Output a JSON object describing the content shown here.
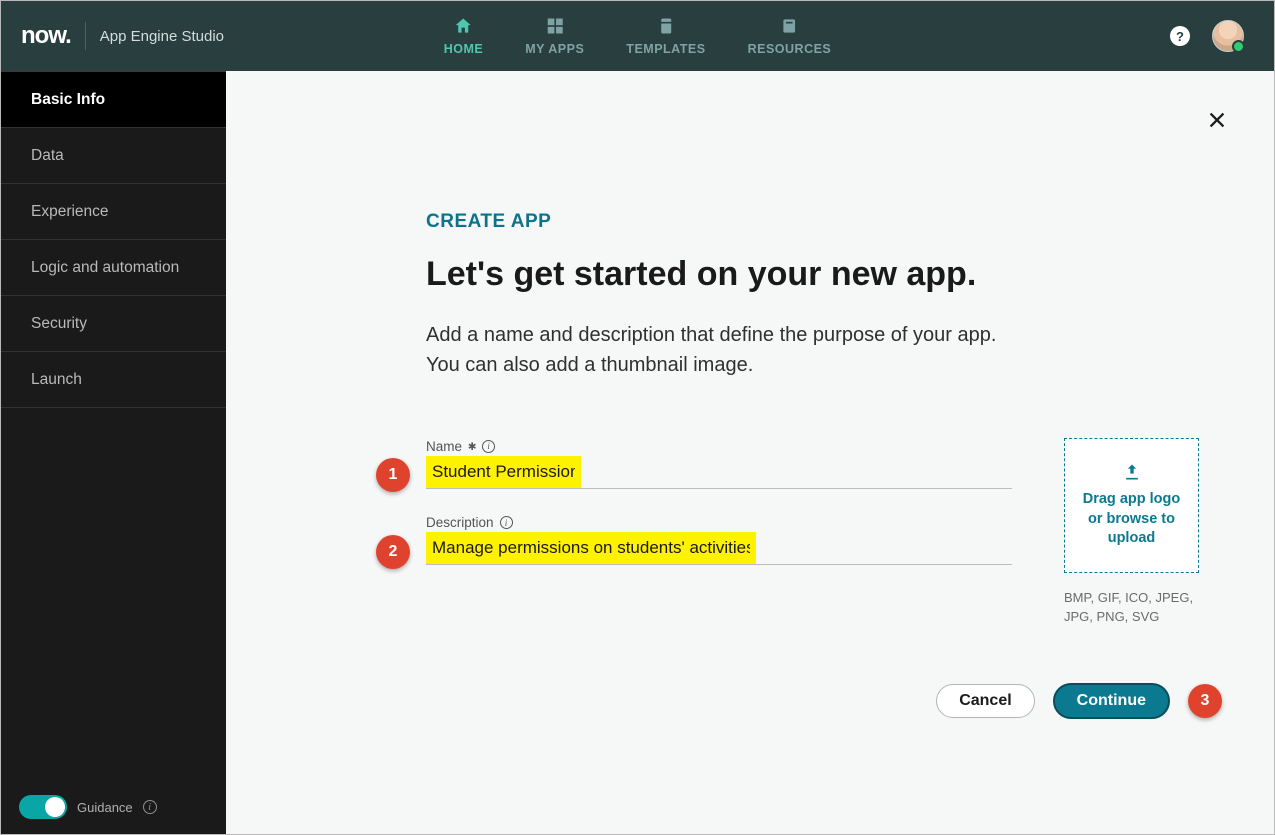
{
  "header": {
    "logo": "now.",
    "title": "App Engine Studio",
    "nav": {
      "home": "HOME",
      "myapps": "MY APPS",
      "templates": "TEMPLATES",
      "resources": "RESOURCES"
    },
    "help": "?"
  },
  "sidebar": {
    "items": [
      "Basic Info",
      "Data",
      "Experience",
      "Logic and automation",
      "Security",
      "Launch"
    ],
    "guidance": "Guidance"
  },
  "main": {
    "eyebrow": "CREATE APP",
    "heading": "Let's get started on your new app.",
    "lead1": "Add a name and description that define the purpose of your app.",
    "lead2": "You can also add a thumbnail image.",
    "name_label": "Name",
    "required_glyph": "✱",
    "name_value": "Student Permission",
    "desc_label": "Description",
    "desc_value": "Manage permissions on students' activities",
    "dropzone_line1": "Drag app logo",
    "dropzone_line2": "or browse to",
    "dropzone_line3": "upload",
    "formats": "BMP, GIF, ICO, JPEG, JPG, PNG, SVG",
    "cancel": "Cancel",
    "continue": "Continue",
    "callouts": {
      "name": "1",
      "desc": "2",
      "continue": "3"
    }
  }
}
